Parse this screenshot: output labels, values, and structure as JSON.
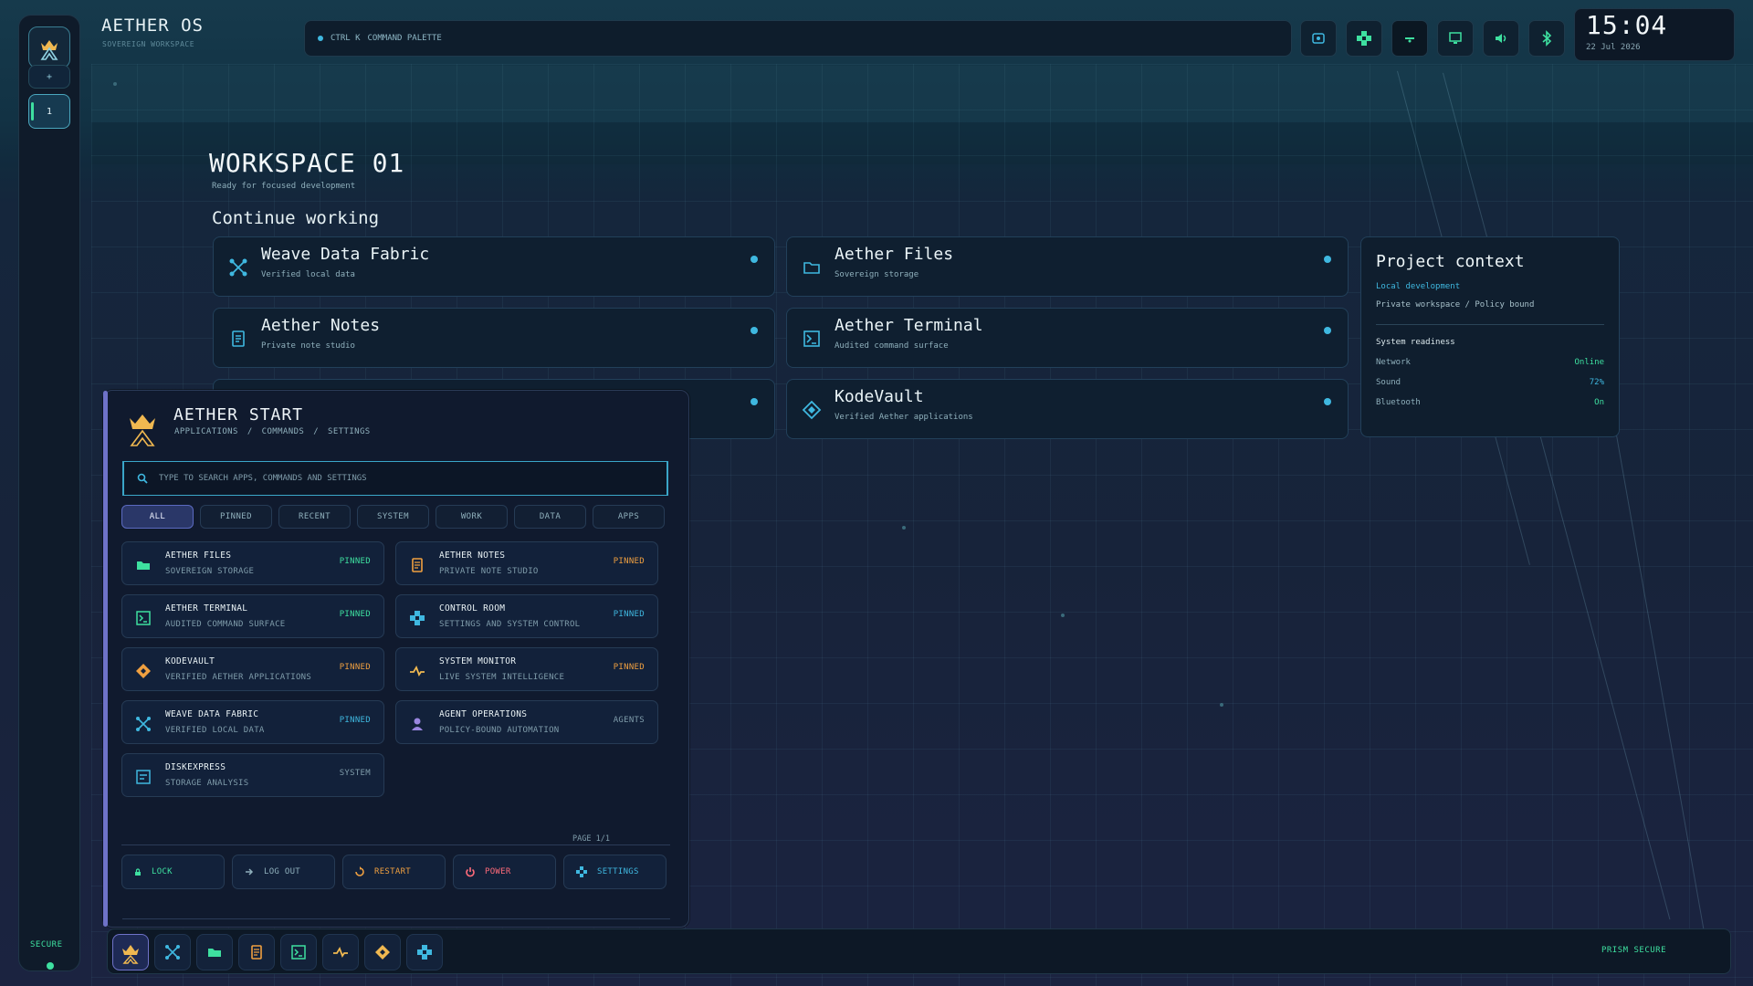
{
  "system": {
    "name": "AETHER OS",
    "subtitle": "SOVEREIGN WORKSPACE",
    "command": {
      "shortcut": "CTRL K",
      "label": "COMMAND PALETTE"
    },
    "clock": {
      "time": "15:04",
      "date": "22 Jul 2026"
    },
    "tray_icons": [
      "screen-record-icon",
      "control-room-icon",
      "network-icon",
      "display-icon",
      "sound-icon",
      "bluetooth-icon"
    ]
  },
  "sidebar": {
    "add_label": "+",
    "workspace_label": "1",
    "secure_label": "SECURE"
  },
  "workspace": {
    "title": "WORKSPACE 01",
    "subtitle": "Ready for focused development",
    "continue_title": "Continue working",
    "cards": [
      {
        "title": "Weave Data Fabric",
        "subtitle": "Verified local data",
        "icon": "weave-icon"
      },
      {
        "title": "Aether Files",
        "subtitle": "Sovereign storage",
        "icon": "folder-icon"
      },
      {
        "title": "Aether Notes",
        "subtitle": "Private note studio",
        "icon": "notes-icon"
      },
      {
        "title": "Aether Terminal",
        "subtitle": "Audited command surface",
        "icon": "terminal-icon"
      },
      {
        "title": "KodeVault",
        "subtitle": "Verified Aether applications",
        "icon": "vault-icon"
      }
    ]
  },
  "context": {
    "title": "Project context",
    "mode": "Local development",
    "scope": "Private workspace / Policy bound",
    "readiness_title": "System readiness",
    "rows": [
      {
        "label": "Network",
        "value": "Online"
      },
      {
        "label": "Sound",
        "value": "72%"
      },
      {
        "label": "Bluetooth",
        "value": "On"
      }
    ]
  },
  "start": {
    "title": "AETHER START",
    "crumbs": [
      "APPLICATIONS",
      "/",
      "COMMANDS",
      "/",
      "SETTINGS"
    ],
    "search_placeholder": "TYPE TO SEARCH APPS, COMMANDS AND SETTINGS",
    "tabs": [
      "ALL",
      "PINNED",
      "RECENT",
      "SYSTEM",
      "WORK",
      "DATA",
      "APPS"
    ],
    "apps": [
      {
        "name": "AETHER FILES",
        "desc": "SOVEREIGN STORAGE",
        "tag": "PINNED",
        "tag_color": "green",
        "icon": "folder-icon"
      },
      {
        "name": "AETHER NOTES",
        "desc": "PRIVATE NOTE STUDIO",
        "tag": "PINNED",
        "tag_color": "orange",
        "icon": "notes-icon"
      },
      {
        "name": "AETHER TERMINAL",
        "desc": "AUDITED COMMAND SURFACE",
        "tag": "PINNED",
        "tag_color": "green",
        "icon": "terminal-icon"
      },
      {
        "name": "CONTROL ROOM",
        "desc": "SETTINGS AND SYSTEM CONTROL",
        "tag": "PINNED",
        "tag_color": "blue",
        "icon": "control-room-icon"
      },
      {
        "name": "KODEVAULT",
        "desc": "VERIFIED AETHER APPLICATIONS",
        "tag": "PINNED",
        "tag_color": "orange",
        "icon": "vault-icon"
      },
      {
        "name": "SYSTEM MONITOR",
        "desc": "LIVE SYSTEM INTELLIGENCE",
        "tag": "PINNED",
        "tag_color": "orange",
        "icon": "monitor-icon"
      },
      {
        "name": "WEAVE DATA FABRIC",
        "desc": "VERIFIED LOCAL DATA",
        "tag": "PINNED",
        "tag_color": "blue",
        "icon": "weave-icon"
      },
      {
        "name": "AGENT OPERATIONS",
        "desc": "POLICY-BOUND AUTOMATION",
        "tag": "AGENTS",
        "tag_color": "gray",
        "icon": "agent-icon"
      },
      {
        "name": "DISKEXPRESS",
        "desc": "STORAGE ANALYSIS",
        "tag": "SYSTEM",
        "tag_color": "gray",
        "icon": "disk-icon"
      }
    ],
    "page": "PAGE 1/1",
    "footer": [
      {
        "label": "LOCK",
        "color": "#3ee0a0",
        "icon": "lock-icon"
      },
      {
        "label": "LOG OUT",
        "color": "#8fb0bc",
        "icon": "logout-icon"
      },
      {
        "label": "RESTART",
        "color": "#f0a040",
        "icon": "restart-icon"
      },
      {
        "label": "POWER",
        "color": "#ff6b7a",
        "icon": "power-icon"
      },
      {
        "label": "SETTINGS",
        "color": "#3fb8e0",
        "icon": "settings-icon"
      }
    ]
  },
  "dock": {
    "items": [
      "aether-start-icon",
      "weave-icon",
      "folder-icon",
      "notes-icon",
      "terminal-icon",
      "monitor-icon",
      "vault-icon",
      "control-room-icon"
    ],
    "status": "PRISM SECURE"
  },
  "colors": {
    "accent_green": "#3ee0a0",
    "accent_blue": "#3fb8e0",
    "accent_orange": "#f0a040",
    "accent_purple": "#6e72c8",
    "danger": "#ff6b7a"
  }
}
